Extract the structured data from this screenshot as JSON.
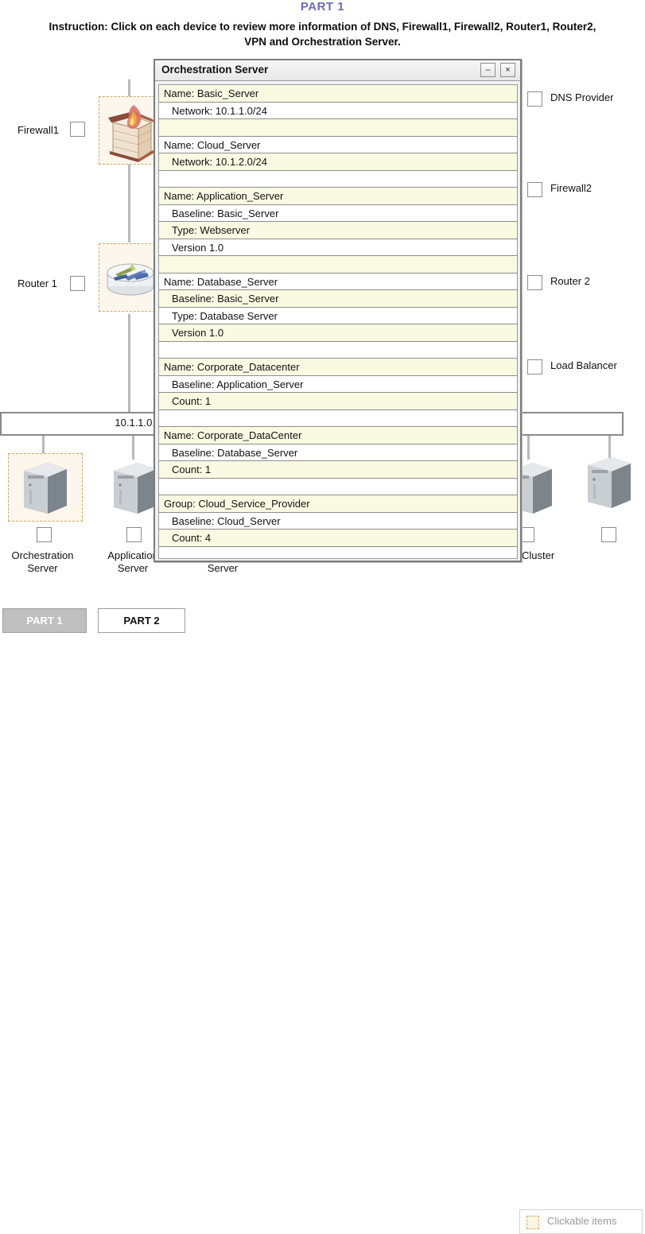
{
  "header": {
    "part_title": "PART 1",
    "instruction": "Instruction: Click on each device to review more information of DNS, Firewall1, Firewall2, Router1, Router2, VPN and Orchestration Server."
  },
  "dialog": {
    "title": "Orchestration Server",
    "minimize_label": "–",
    "close_label": "×",
    "rows": [
      {
        "text": "Name: Basic_Server",
        "shade": "cream",
        "indent": false
      },
      {
        "text": "Network: 10.1.1.0/24",
        "shade": "white",
        "indent": true
      },
      {
        "text": "",
        "shade": "cream",
        "indent": false
      },
      {
        "text": "Name: Cloud_Server",
        "shade": "white",
        "indent": false
      },
      {
        "text": "Network: 10.1.2.0/24",
        "shade": "cream",
        "indent": true
      },
      {
        "text": "",
        "shade": "white",
        "indent": false
      },
      {
        "text": "Name: Application_Server",
        "shade": "cream",
        "indent": false
      },
      {
        "text": "Baseline: Basic_Server",
        "shade": "white",
        "indent": true
      },
      {
        "text": "Type: Webserver",
        "shade": "cream",
        "indent": true
      },
      {
        "text": "Version 1.0",
        "shade": "white",
        "indent": true
      },
      {
        "text": "",
        "shade": "cream",
        "indent": false
      },
      {
        "text": "Name: Database_Server",
        "shade": "white",
        "indent": false
      },
      {
        "text": "Baseline: Basic_Server",
        "shade": "cream",
        "indent": true
      },
      {
        "text": "Type: Database Server",
        "shade": "white",
        "indent": true
      },
      {
        "text": "Version 1.0",
        "shade": "cream",
        "indent": true
      },
      {
        "text": "",
        "shade": "white",
        "indent": false
      },
      {
        "text": "Name: Corporate_Datacenter",
        "shade": "cream",
        "indent": false
      },
      {
        "text": "Baseline: Application_Server",
        "shade": "white",
        "indent": true
      },
      {
        "text": "Count: 1",
        "shade": "cream",
        "indent": true
      },
      {
        "text": "",
        "shade": "white",
        "indent": false
      },
      {
        "text": "Name: Corporate_DataCenter",
        "shade": "cream",
        "indent": false
      },
      {
        "text": "Baseline: Database_Server",
        "shade": "white",
        "indent": true
      },
      {
        "text": "Count: 1",
        "shade": "cream",
        "indent": true
      },
      {
        "text": "",
        "shade": "white",
        "indent": false
      },
      {
        "text": "Group: Cloud_Service_Provider",
        "shade": "cream",
        "indent": false
      },
      {
        "text": "Baseline: Cloud_Server",
        "shade": "white",
        "indent": true
      },
      {
        "text": "Count: 4",
        "shade": "cream",
        "indent": true
      },
      {
        "text": "",
        "shade": "white",
        "indent": false
      }
    ]
  },
  "diagram": {
    "network_bar_label": "10.1.1.0.",
    "left_devices": [
      {
        "label": "Firewall1",
        "icon": "firewall-icon"
      },
      {
        "label": "Router 1",
        "icon": "router-icon"
      }
    ],
    "right_devices": [
      {
        "label": "DNS Provider"
      },
      {
        "label": "Firewall2"
      },
      {
        "label": "Router 2"
      },
      {
        "label": "Load Balancer"
      }
    ],
    "bottom_devices": [
      {
        "line1": "Orchestration",
        "line2": "Server"
      },
      {
        "line1": "Application",
        "line2": "Server"
      },
      {
        "line1": "",
        "line2": "Server"
      },
      {
        "line1": "Cluster",
        "line2": ""
      },
      {
        "line1": "",
        "line2": ""
      }
    ]
  },
  "footer": {
    "part1_label": "PART 1",
    "part2_label": "PART 2",
    "legend_label": "Clickable items"
  },
  "colors": {
    "title_purple": "#6b6bb8",
    "row_cream": "#fafae3",
    "hotspot_border": "#c9a96a",
    "hotspot_fill": "#fdf6ec",
    "disabled_button": "#bfbfbf"
  }
}
